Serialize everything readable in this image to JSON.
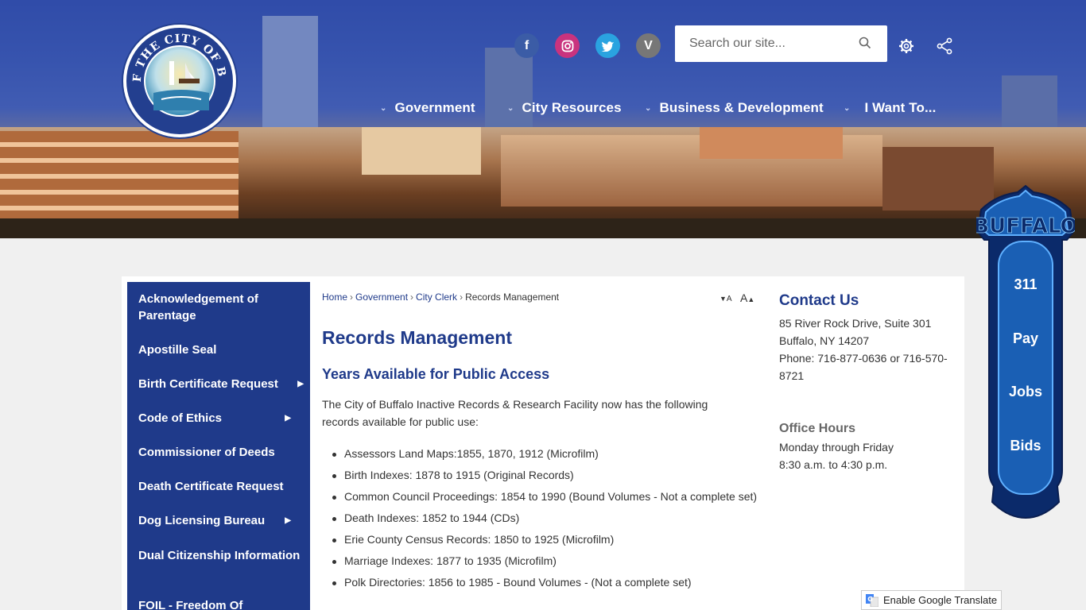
{
  "header": {
    "logo_alt": "SEAL OF THE CITY OF BUFFALO",
    "search": {
      "placeholder": "Search our site..."
    },
    "social": [
      {
        "name": "facebook-icon",
        "glyph": "f"
      },
      {
        "name": "instagram-icon",
        "glyph": "◎"
      },
      {
        "name": "twitter-icon",
        "glyph": "🐦"
      },
      {
        "name": "vimeo-icon",
        "glyph": "V"
      }
    ],
    "nav": [
      "Government",
      "City Resources",
      "Business & Development",
      "I Want To..."
    ]
  },
  "sidebar": {
    "items": [
      {
        "label": "Acknowledgement of Parentage",
        "has_submenu": false
      },
      {
        "label": "Apostille Seal",
        "has_submenu": false
      },
      {
        "label": "Birth Certificate Request",
        "has_submenu": true
      },
      {
        "label": "Code of Ethics",
        "has_submenu": true
      },
      {
        "label": "Commissioner of Deeds",
        "has_submenu": false
      },
      {
        "label": "Death Certificate Request",
        "has_submenu": false
      },
      {
        "label": "Dog Licensing Bureau",
        "has_submenu": true
      },
      {
        "label": "Dual Citizenship Information",
        "has_submenu": false
      },
      {
        "label": "FOIL - Freedom Of",
        "has_submenu": false
      }
    ]
  },
  "breadcrumb": {
    "home": "Home",
    "government": "Government",
    "city_clerk": "City Clerk",
    "current": "Records Management"
  },
  "font_controls": {
    "decrease": "A",
    "increase": "A"
  },
  "main": {
    "title": "Records Management",
    "subtitle": "Years Available for Public Access",
    "intro": "The City of Buffalo Inactive Records & Research Facility now has the following records available for public use:",
    "records": [
      "Assessors Land Maps:1855, 1870, 1912 (Microfilm)",
      "Birth Indexes: 1878 to 1915 (Original Records)",
      "Common Council Proceedings: 1854 to 1990 (Bound Volumes - Not a complete set)",
      "Death Indexes: 1852 to 1944 (CDs)",
      "Erie County Census Records: 1850 to 1925 (Microfilm)",
      "Marriage Indexes: 1877 to 1935 (Microfilm)",
      "Polk Directories: 1856 to 1985 - Bound Volumes - (Not a complete set)"
    ]
  },
  "contact": {
    "title": "Contact Us",
    "address1": "85 River Rock Drive, Suite 301",
    "address2": "Buffalo, NY 14207",
    "phone": "Phone: 716-877-0636 or 716-570-8721",
    "hours_title": "Office Hours",
    "hours_days": "Monday through Friday",
    "hours_time": "8:30 a.m. to 4:30 p.m."
  },
  "sign": {
    "brand": "BUFFALO",
    "links": [
      "311",
      "Pay",
      "Jobs",
      "Bids"
    ]
  },
  "translate": {
    "label": "Enable Google Translate"
  },
  "colors": {
    "brand_blue": "#1f3a8a",
    "sign_blue": "#1a5fb4",
    "text": "#333333"
  }
}
